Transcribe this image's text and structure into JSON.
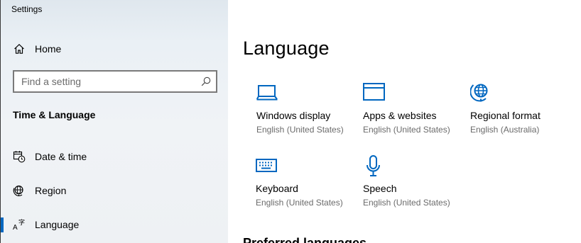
{
  "window": {
    "title": "Settings"
  },
  "sidebar": {
    "home_label": "Home",
    "search": {
      "placeholder": "Find a setting",
      "value": ""
    },
    "section_heading": "Time & Language",
    "items": [
      {
        "label": "Date & time",
        "icon": "date-time-icon"
      },
      {
        "label": "Region",
        "icon": "region-globe-icon"
      },
      {
        "label": "Language",
        "icon": "language-icon",
        "active": true
      }
    ]
  },
  "main": {
    "title": "Language",
    "tiles": [
      {
        "title": "Windows display",
        "subtitle": "English (United States)",
        "icon": "laptop-icon"
      },
      {
        "title": "Apps & websites",
        "subtitle": "English (United States)",
        "icon": "browser-window-icon"
      },
      {
        "title": "Regional format",
        "subtitle": "English (Australia)",
        "icon": "globe-pin-icon"
      },
      {
        "title": "Keyboard",
        "subtitle": "English (United States)",
        "icon": "keyboard-icon"
      },
      {
        "title": "Speech",
        "subtitle": "English (United States)",
        "icon": "microphone-icon"
      }
    ],
    "next_heading": "Preferred languages"
  },
  "colors": {
    "accent": "#0067c0",
    "secondary_text": "#6b6b6b"
  }
}
